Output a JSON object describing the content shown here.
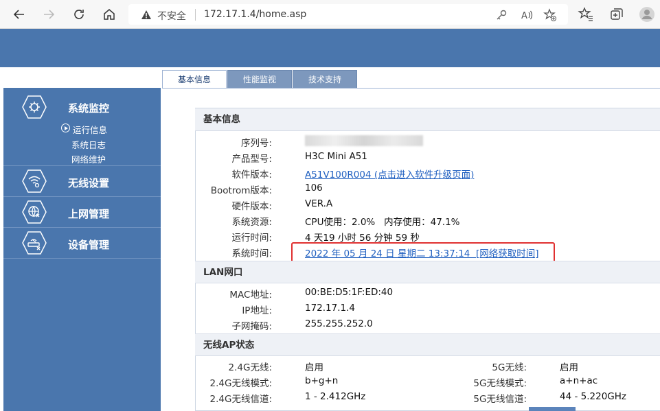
{
  "browser": {
    "security_label": "不安全",
    "url": "172.17.1.4/home.asp"
  },
  "tabs": [
    {
      "label": "基本信息"
    },
    {
      "label": "性能监视"
    },
    {
      "label": "技术支持"
    }
  ],
  "sidebar": {
    "items": [
      {
        "label": "系统监控"
      },
      {
        "label": "无线设置"
      },
      {
        "label": "上网管理"
      },
      {
        "label": "设备管理"
      }
    ],
    "subitems": [
      {
        "label": "运行信息"
      },
      {
        "label": "系统日志"
      },
      {
        "label": "网络维护"
      }
    ]
  },
  "basic": {
    "title": "基本信息",
    "rows": [
      {
        "label": "序列号:",
        "value": ""
      },
      {
        "label": "产品型号:",
        "value": "H3C Mini A51"
      },
      {
        "label": "软件版本:",
        "value": "A51V100R004  (点击进入软件升级页面)"
      },
      {
        "label": "Bootrom版本:",
        "value": "106"
      },
      {
        "label": "硬件版本:",
        "value": "VER.A"
      },
      {
        "label": "系统资源:",
        "value": "CPU使用：2.0%   内存使用：47.1%"
      },
      {
        "label": "运行时间:",
        "value": "4 天19 小时 56 分钟 59 秒"
      },
      {
        "label": "系统时间:",
        "value": "2022 年 05 月 24 日 星期二 13:37:14  [网络获取时间]"
      }
    ]
  },
  "lan": {
    "title": "LAN网口",
    "rows": [
      {
        "label": "MAC地址:",
        "value": "00:BE:D5:1F:ED:40"
      },
      {
        "label": "IP地址:",
        "value": "172.17.1.4"
      },
      {
        "label": "子网掩码:",
        "value": "255.255.252.0"
      }
    ]
  },
  "wireless": {
    "title": "无线AP状态",
    "left": [
      {
        "label": "2.4G无线:",
        "value": "启用"
      },
      {
        "label": "2.4G无线模式:",
        "value": "b+g+n"
      },
      {
        "label": "2.4G无线信道:",
        "value": "1 - 2.412GHz"
      }
    ],
    "right": [
      {
        "label": "5G无线:",
        "value": "启用"
      },
      {
        "label": "5G无线模式:",
        "value": "a+n+ac"
      },
      {
        "label": "5G无线信道:",
        "value": "44 - 5.220GHz"
      }
    ]
  },
  "colors": {
    "brand": "#4a76ad",
    "link": "#1f5fc0",
    "highlight": "#e03030"
  }
}
